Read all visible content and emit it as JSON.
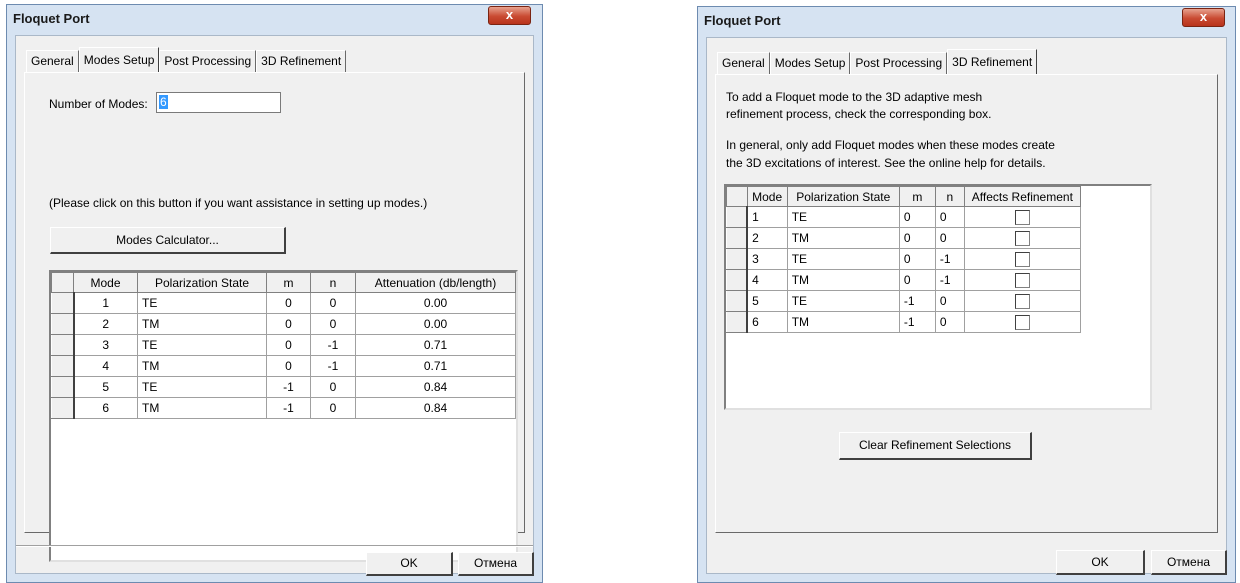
{
  "dialog_left": {
    "title": "Floquet Port",
    "close_label": "x",
    "tabs": [
      "General",
      "Modes Setup",
      "Post Processing",
      "3D Refinement"
    ],
    "number_of_modes_label": "Number of Modes:",
    "number_of_modes_value": "6",
    "assist_text": "(Please click on this button if you want assistance in setting up modes.)",
    "modes_calculator_label": "Modes Calculator...",
    "table": {
      "headers": [
        "Mode",
        "Polarization State",
        "m",
        "n",
        "Attenuation (db/length)"
      ],
      "rows": [
        [
          "1",
          "TE",
          "0",
          "0",
          "0.00"
        ],
        [
          "2",
          "TM",
          "0",
          "0",
          "0.00"
        ],
        [
          "3",
          "TE",
          "0",
          "-1",
          "0.71"
        ],
        [
          "4",
          "TM",
          "0",
          "-1",
          "0.71"
        ],
        [
          "5",
          "TE",
          "-1",
          "0",
          "0.84"
        ],
        [
          "6",
          "TM",
          "-1",
          "0",
          "0.84"
        ]
      ]
    },
    "ok_label": "OK",
    "cancel_label": "Отмена"
  },
  "dialog_right": {
    "title": "Floquet Port",
    "close_label": "x",
    "tabs": [
      "General",
      "Modes Setup",
      "Post Processing",
      "3D Refinement"
    ],
    "info_line1": "To add a Floquet mode to the 3D adaptive mesh",
    "info_line2": "refinement process, check the corresponding box.",
    "info_line3": "In general, only add Floquet modes when these modes create",
    "info_line4": "the 3D excitations of interest.  See the online help for details.",
    "table": {
      "headers": [
        "Mode",
        "Polarization State",
        "m",
        "n",
        "Affects Refinement"
      ],
      "rows": [
        [
          "1",
          "TE",
          "0",
          "0"
        ],
        [
          "2",
          "TM",
          "0",
          "0"
        ],
        [
          "3",
          "TE",
          "0",
          "-1"
        ],
        [
          "4",
          "TM",
          "0",
          "-1"
        ],
        [
          "5",
          "TE",
          "-1",
          "0"
        ],
        [
          "6",
          "TM",
          "-1",
          "0"
        ]
      ]
    },
    "clear_label": "Clear Refinement Selections",
    "ok_label": "OK",
    "cancel_label": "Отмена"
  }
}
